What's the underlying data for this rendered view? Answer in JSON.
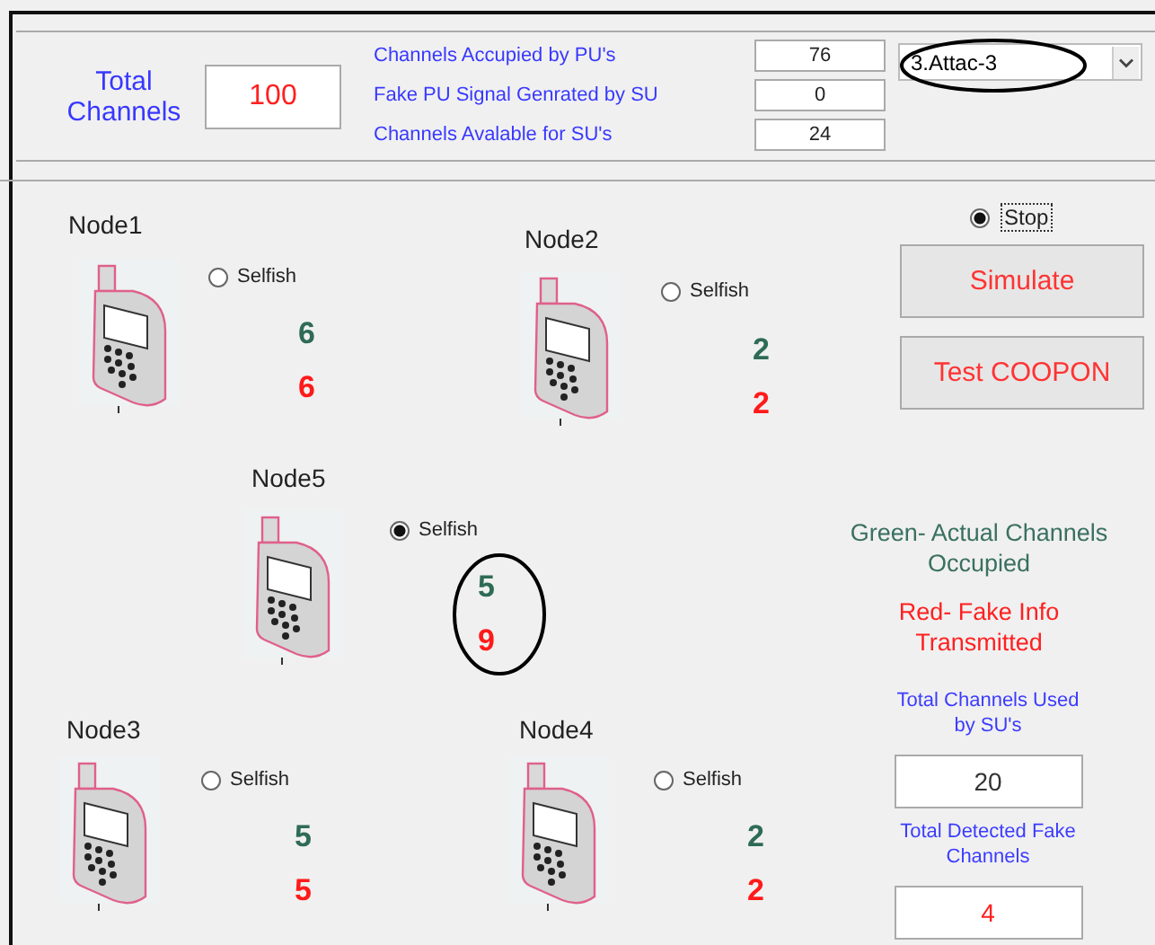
{
  "header": {
    "total_label": "Total Channels",
    "total_value": "100",
    "stats": [
      {
        "label": "Channels Accupied by PU's",
        "value": "76"
      },
      {
        "label": "Fake PU Signal Genrated by SU",
        "value": "0"
      },
      {
        "label": "Channels Avalable for SU's",
        "value": "24"
      }
    ],
    "attack_select": "3.Attac-3"
  },
  "nodes": [
    {
      "name": "Node1",
      "selfish": false,
      "radio_label": "Selfish",
      "actual": "6",
      "fake": "6"
    },
    {
      "name": "Node2",
      "selfish": false,
      "radio_label": "Selfish",
      "actual": "2",
      "fake": "2"
    },
    {
      "name": "Node5",
      "selfish": true,
      "radio_label": "Selfish",
      "actual": "5",
      "fake": "9"
    },
    {
      "name": "Node3",
      "selfish": false,
      "radio_label": "Selfish",
      "actual": "5",
      "fake": "5"
    },
    {
      "name": "Node4",
      "selfish": false,
      "radio_label": "Selfish",
      "actual": "2",
      "fake": "2"
    }
  ],
  "stop": {
    "label": "Stop",
    "selected": true
  },
  "buttons": [
    "Simulate",
    "Test COOPON"
  ],
  "legend": [
    {
      "kind": "actual",
      "text": "Green- Actual Channels Occupied"
    },
    {
      "kind": "fake",
      "text": "Red- Fake Info Transmitted"
    }
  ],
  "totals": [
    {
      "kind": "actual",
      "label": "Total Channels Used by SU's",
      "value": "20"
    },
    {
      "kind": "fake",
      "label": "Total Detected Fake Channels",
      "value": "4"
    }
  ]
}
